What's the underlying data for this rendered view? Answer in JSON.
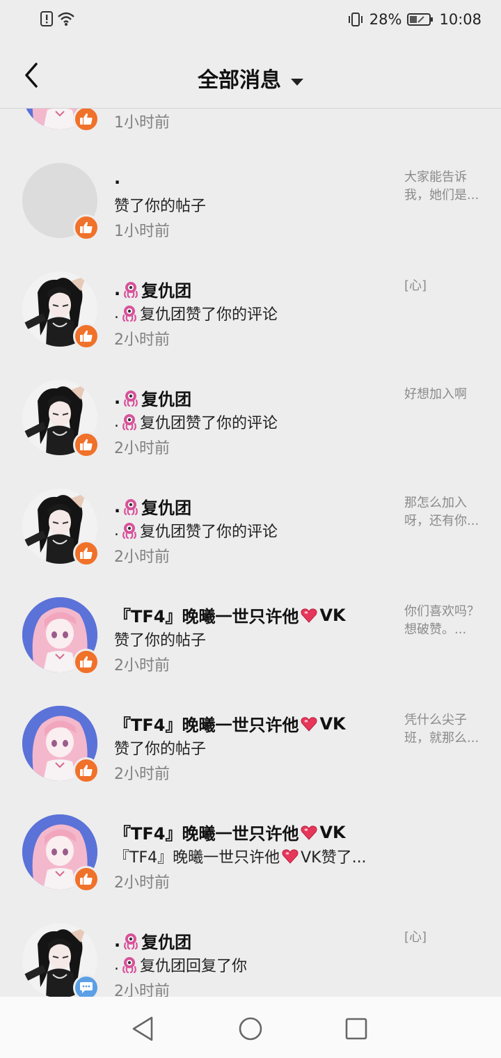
{
  "status_bar": {
    "battery": "28%",
    "time": "10:08"
  },
  "header": {
    "title": "全部消息",
    "back_icon": "chevron-left-icon",
    "dropdown_icon": "caret-down-icon"
  },
  "messages": [
    {
      "name": "",
      "action": "",
      "time": "1小时前",
      "preview": "",
      "avatar": "pink-anime",
      "badge": "like"
    },
    {
      "name": ".",
      "action": "赞了你的帖子",
      "time": "1小时前",
      "preview": "大家能告诉我，她们是...",
      "avatar": "blank",
      "badge": "like"
    },
    {
      "name_prefix": ".",
      "name": "复仇团",
      "action_prefix": ".",
      "action": "复仇团赞了你的评论",
      "time": "2小时前",
      "preview": "[心]",
      "avatar": "dark-anime",
      "badge": "like"
    },
    {
      "name_prefix": ".",
      "name": "复仇团",
      "action_prefix": ".",
      "action": "复仇团赞了你的评论",
      "time": "2小时前",
      "preview": "好想加入啊",
      "avatar": "dark-anime",
      "badge": "like"
    },
    {
      "name_prefix": ".",
      "name": "复仇团",
      "action_prefix": ".",
      "action": "复仇团赞了你的评论",
      "time": "2小时前",
      "preview": "那怎么加入呀，还有你...",
      "avatar": "dark-anime",
      "badge": "like"
    },
    {
      "name": "『TF4』晚曦一世只许他",
      "name_suffix": "VK",
      "action": "赞了你的帖子",
      "time": "2小时前",
      "preview": "你们喜欢吗？想破赞。...",
      "avatar": "pink-anime",
      "badge": "like"
    },
    {
      "name": "『TF4』晚曦一世只许他",
      "name_suffix": "VK",
      "action": "赞了你的帖子",
      "time": "2小时前",
      "preview": "凭什么尖子班，就那么...",
      "avatar": "pink-anime",
      "badge": "like"
    },
    {
      "name": "『TF4』晚曦一世只许他",
      "name_suffix": "VK",
      "action": "『TF4』晚曦一世只许他",
      "action_suffix": "VK赞了...",
      "time": "2小时前",
      "preview": "",
      "avatar": "pink-anime",
      "badge": "like"
    },
    {
      "name_prefix": ".",
      "name": "复仇团",
      "action_prefix": ".",
      "action": "复仇团回复了你",
      "time": "2小时前",
      "preview": "[心]",
      "avatar": "dark-anime",
      "badge": "comment"
    }
  ],
  "nav": {
    "back": "back-triangle-icon",
    "home": "home-circle-icon",
    "recents": "recents-square-icon"
  }
}
